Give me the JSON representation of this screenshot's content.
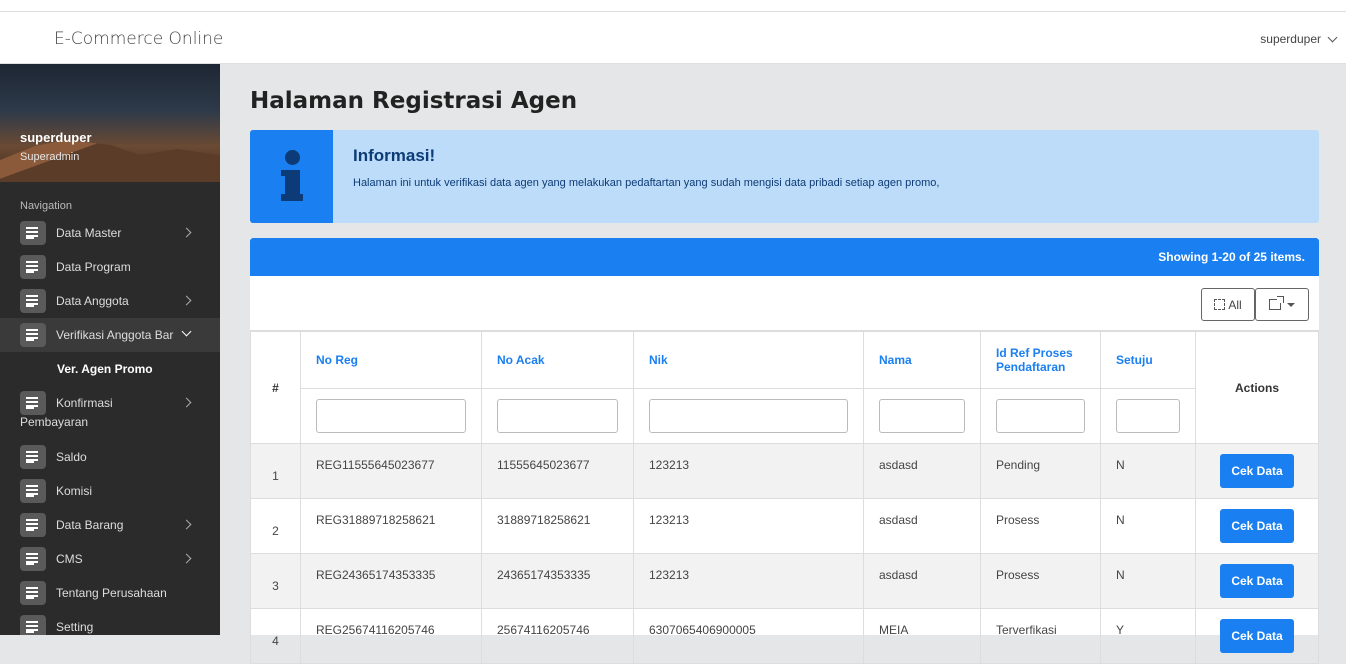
{
  "app": {
    "brand": "E-Commerce Online",
    "user": "superduper"
  },
  "sidebar": {
    "profile": {
      "name": "superduper",
      "role": "Superadmin"
    },
    "nav_title": "Navigation",
    "items": [
      {
        "label": "Data Master"
      },
      {
        "label": "Data Program"
      },
      {
        "label": "Data Anggota"
      },
      {
        "label": "Verifikasi Anggota Bar"
      },
      {
        "label": "Ver. Agen Promo"
      },
      {
        "label": "Konfirmasi",
        "label2": "Pembayaran"
      },
      {
        "label": "Saldo"
      },
      {
        "label": "Komisi"
      },
      {
        "label": "Data Barang"
      },
      {
        "label": "CMS"
      },
      {
        "label": "Tentang Perusahaan"
      },
      {
        "label": "Setting"
      }
    ]
  },
  "page": {
    "title": "Halaman Registrasi Agen"
  },
  "info": {
    "title": "Informasi!",
    "text": "Halaman ini untuk verifikasi data agen yang melakukan pedaftartan yang sudah mengisi data pribadi setiap agen promo,"
  },
  "grid": {
    "summary": "Showing 1-20 of 25 items.",
    "all_label": "All",
    "columns": {
      "hash": "#",
      "no_reg": "No Reg",
      "no_acak": "No Acak",
      "nik": "Nik",
      "nama": "Nama",
      "id_ref": "Id Ref Proses Pendaftaran",
      "setuju": "Setuju",
      "actions": "Actions"
    },
    "action_label": "Cek Data",
    "rows": [
      {
        "no": "1",
        "no_reg": "REG11555645023677",
        "no_acak": "11555645023677",
        "nik": "123213",
        "nama": "asdasd",
        "status": "Pending",
        "setuju": "N"
      },
      {
        "no": "2",
        "no_reg": "REG31889718258621",
        "no_acak": "31889718258621",
        "nik": "123213",
        "nama": "asdasd",
        "status": "Prosess",
        "setuju": "N"
      },
      {
        "no": "3",
        "no_reg": "REG24365174353335",
        "no_acak": "24365174353335",
        "nik": "123213",
        "nama": "asdasd",
        "status": "Prosess",
        "setuju": "N"
      },
      {
        "no": "4",
        "no_reg": "REG25674116205746",
        "no_acak": "25674116205746",
        "nik": "6307065406900005",
        "nama": "MEIA",
        "status": "Terverfikasi",
        "setuju": "Y"
      }
    ]
  }
}
